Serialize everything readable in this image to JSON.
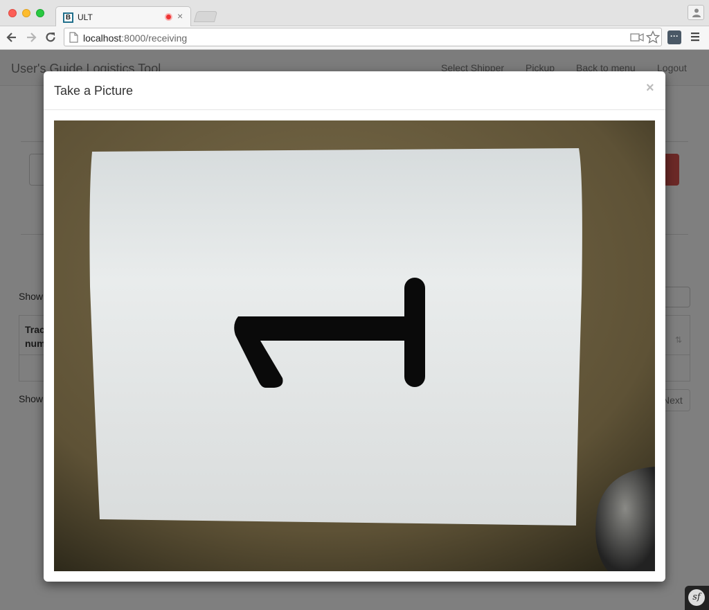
{
  "browser": {
    "tab": {
      "favicon_letter": "B",
      "title": "ULT",
      "close_symbol": "×",
      "recording_icon": "record-icon"
    },
    "address": {
      "host": "localhost",
      "port_path": ":8000/receiving"
    },
    "icons": [
      "back-icon",
      "forward-icon",
      "reload-icon",
      "page-icon",
      "camera-icon",
      "star-icon",
      "extension-icon",
      "menu-icon",
      "profile-icon"
    ],
    "extension_label": "···"
  },
  "app": {
    "brand": "User's Guide Logistics Tool",
    "nav": [
      "Select Shipper",
      "Pickup",
      "Back to menu",
      "Logout"
    ],
    "table": {
      "show_top": "Show",
      "header": "Tracking number",
      "show_bottom": "Show",
      "next": "Next"
    }
  },
  "modal": {
    "title": "Take a Picture",
    "close_symbol": "×",
    "camera_feed": {
      "content": "white sheet of paper with a large numeral",
      "numeral": "1",
      "colors": {
        "background": "#6b5e3f",
        "paper": "#e6e9ea",
        "ink": "#0a0a0a"
      }
    }
  },
  "footer": {
    "symfony_badge": "sf"
  }
}
